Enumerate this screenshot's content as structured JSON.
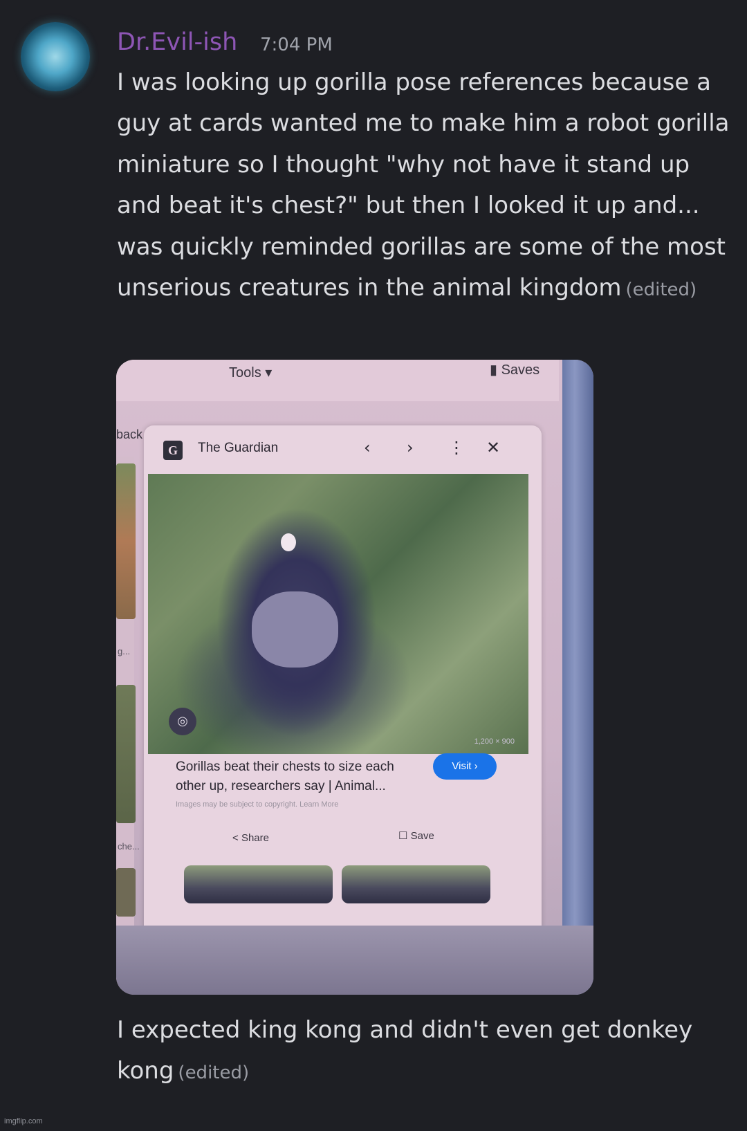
{
  "message": {
    "author": "Dr.Evil-ish",
    "timestamp": "7:04 PM",
    "text1": "I was looking up gorilla pose references because a guy at cards wanted me to make him a robot gorilla miniature so I thought \"why not have it stand up and beat it's chest?\" but then I looked it up and... was quickly reminded gorillas are some of the most unserious creatures in the animal kingdom",
    "text2": "I expected king kong and didn't even get donkey kong",
    "edited_label": "(edited)"
  },
  "photo": {
    "tools_label": "Tools ▾",
    "saves_label": "Saves",
    "back_label": "back",
    "side_text_1": "g...",
    "side_text_2": "che...",
    "card": {
      "source_logo": "G",
      "source_name": "The Guardian",
      "nav_prev": "‹",
      "nav_next": "›",
      "nav_more": "⋮",
      "nav_close": "✕",
      "image_dims": "1,200 × 900",
      "lens_glyph": "◎",
      "caption": "Gorillas beat their chests to size each other up, researchers say | Animal...",
      "visit_label": "Visit ›",
      "copyright": "Images may be subject to copyright. Learn More",
      "share_label": "Share",
      "save_label": "Save"
    }
  },
  "watermark": "imgflip.com"
}
